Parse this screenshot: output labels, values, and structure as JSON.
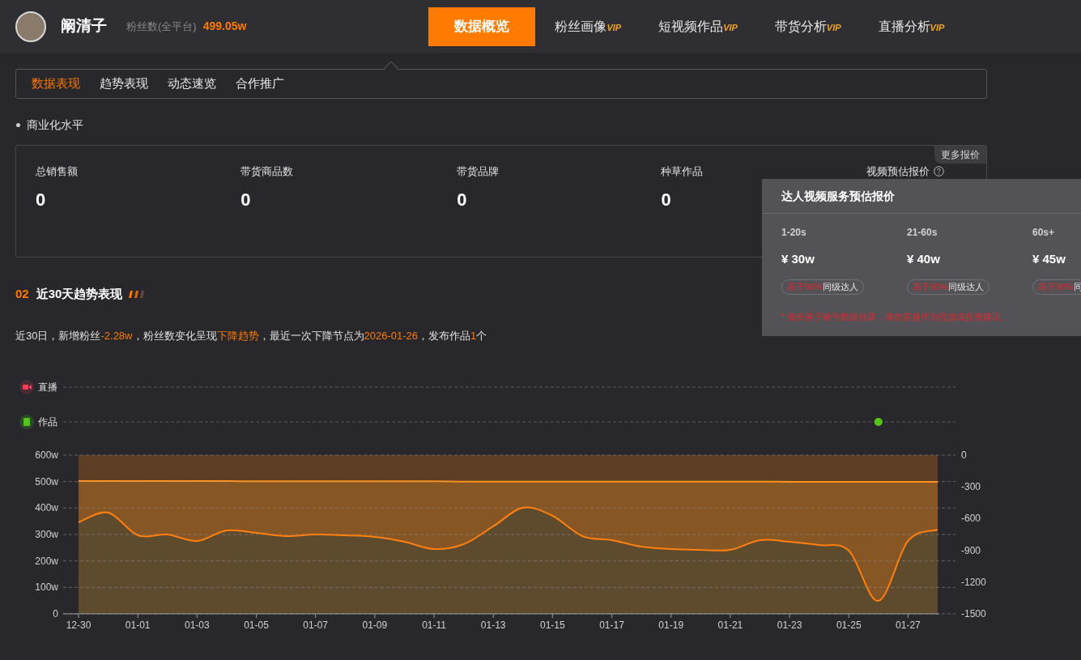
{
  "header": {
    "name": "阚清子",
    "fans_label": "粉丝数(全平台)",
    "fans_value": "499.05w",
    "nav": [
      {
        "label": "数据概览",
        "selected": true
      },
      {
        "label": "粉丝画像",
        "badge": "VIP",
        "selected": false
      },
      {
        "label": "短视频作品",
        "badge": "VIP",
        "selected": false
      },
      {
        "label": "带货分析",
        "badge": "VIP",
        "selected": false
      },
      {
        "label": "直播分析",
        "badge": "VIP",
        "selected": false
      }
    ]
  },
  "subtabs": [
    {
      "label": "数据表现",
      "selected": true
    },
    {
      "label": "趋势表现",
      "selected": false
    },
    {
      "label": "动态速览",
      "selected": false
    },
    {
      "label": "合作推广",
      "selected": false
    }
  ],
  "commerce": {
    "title": "商业化水平",
    "more_label": "更多报价",
    "metrics": [
      {
        "label": "总销售额",
        "value": "0"
      },
      {
        "label": "带货商品数",
        "value": "0"
      },
      {
        "label": "带货品牌",
        "value": "0"
      },
      {
        "label": "种草作品",
        "value": "0"
      },
      {
        "label": "视频预估报价",
        "help": true
      }
    ],
    "popover": {
      "title": "达人视频服务预估报价",
      "columns": [
        {
          "duration": "1-20s",
          "price": "¥ 30w",
          "highlight": "高于90%",
          "suffix": "同级达人"
        },
        {
          "duration": "21-60s",
          "price": "¥ 40w",
          "highlight": "高于90%",
          "suffix": "同级达人"
        },
        {
          "duration": "60s+",
          "price": "¥ 45w",
          "highlight": "高于90%",
          "suffix": "同"
        }
      ],
      "note": "* 报价基于账号数据估算，请勿直接作为投放或投资建议。"
    }
  },
  "trend": {
    "number": "02",
    "title": "近30天趋势表现",
    "summary": [
      {
        "text": "近30日，新增粉丝",
        "highlight": false
      },
      {
        "text": "-2.28w",
        "highlight": true
      },
      {
        "text": "，粉丝数变化呈现",
        "highlight": false
      },
      {
        "text": "下降趋势",
        "highlight": true
      },
      {
        "text": "，最近一次下降节点为",
        "highlight": false
      },
      {
        "text": "2026-01-26",
        "highlight": true
      },
      {
        "text": "，发布作品",
        "highlight": false
      },
      {
        "text": "1",
        "highlight": true
      },
      {
        "text": "个",
        "highlight": false
      }
    ],
    "event_rows": [
      {
        "kind": "live",
        "label": "直播"
      },
      {
        "kind": "work",
        "label": "作品",
        "dots": [
          {
            "level": 0.931
          }
        ]
      }
    ],
    "chart_data": {
      "type": "area",
      "categories": [
        "12-30",
        null,
        "01-01",
        null,
        "01-03",
        null,
        "01-05",
        null,
        "01-07",
        null,
        "01-09",
        null,
        "01-11",
        null,
        "01-13",
        null,
        "01-15",
        null,
        "01-17",
        null,
        "01-19",
        null,
        "01-21",
        null,
        "01-23",
        null,
        "01-25",
        null,
        "01-27",
        null
      ],
      "grid": true,
      "ylim": [
        0,
        600
      ],
      "yticks": [
        {
          "value": 0,
          "label": "0"
        },
        {
          "value": 100,
          "label": "100w"
        },
        {
          "value": 200,
          "label": "200w"
        },
        {
          "value": 300,
          "label": "300w"
        },
        {
          "value": 400,
          "label": "400w"
        },
        {
          "value": 500,
          "label": "500w"
        },
        {
          "value": 600,
          "label": "600w"
        }
      ],
      "y2lim": [
        -1500,
        0
      ],
      "y2ticks": [
        {
          "value": 0,
          "label": "0"
        },
        {
          "value": -300,
          "label": "-300"
        },
        {
          "value": -600,
          "label": "-600"
        },
        {
          "value": -900,
          "label": "-900"
        },
        {
          "value": -1200,
          "label": "-1200"
        },
        {
          "value": -1500,
          "label": "-1500"
        }
      ],
      "series": [
        {
          "color": "#f7931e",
          "values": [
            502,
            502,
            502,
            502,
            502,
            502,
            501,
            501,
            501,
            501,
            501,
            501,
            501,
            500,
            500,
            500,
            500,
            500,
            500,
            500,
            500,
            500,
            500,
            500,
            499,
            499,
            499,
            499,
            499,
            499
          ]
        },
        {
          "color": "#ff7f11",
          "axis": "y2",
          "values": [
            -635,
            -543,
            -758,
            -750,
            -811,
            -712,
            -735,
            -765,
            -750,
            -758,
            -773,
            -819,
            -888,
            -842,
            -673,
            -497,
            -574,
            -765,
            -804,
            -865,
            -888,
            -895,
            -895,
            -804,
            -819,
            -850,
            -903,
            -1378,
            -811,
            -704
          ]
        }
      ]
    }
  }
}
